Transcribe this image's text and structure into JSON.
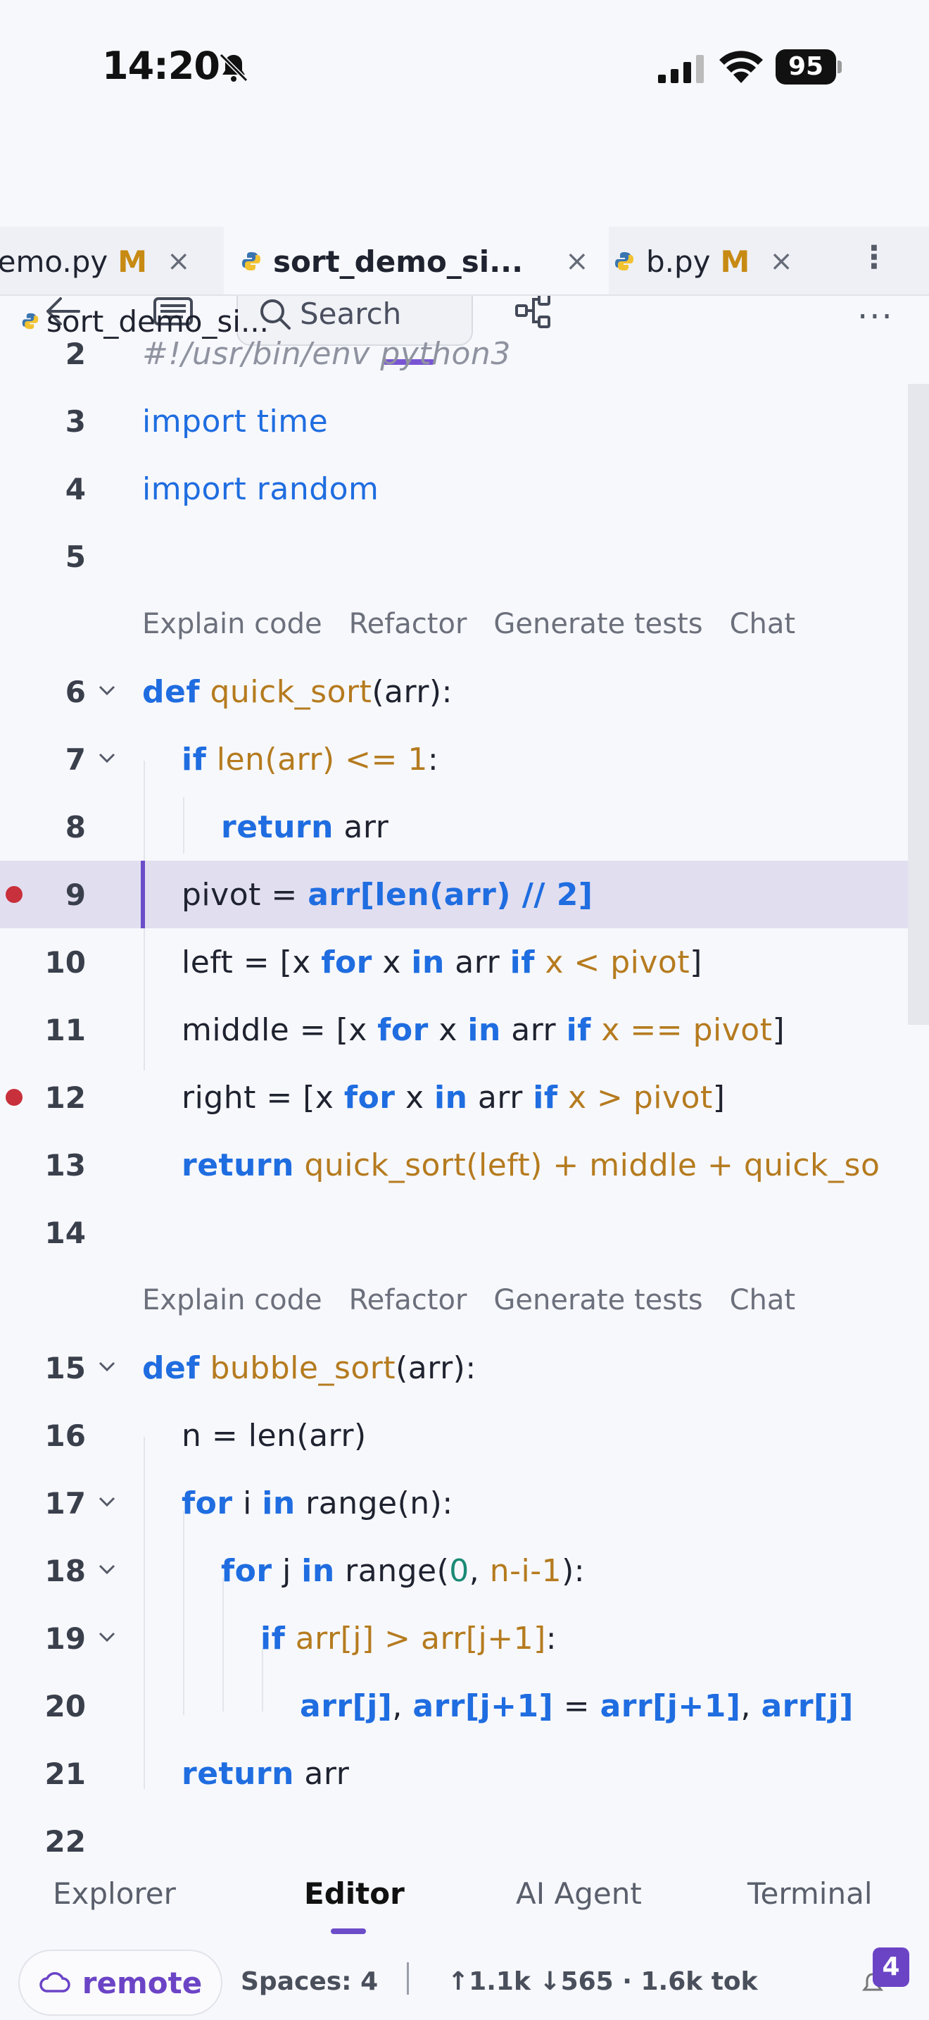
{
  "status_bar": {
    "time": "14:20",
    "battery": "95"
  },
  "toolbar": {
    "search_placeholder": "Search"
  },
  "tabs": [
    {
      "name": "demo.py",
      "modified": "M",
      "close": "×"
    },
    {
      "name": "sort_demo_si...",
      "modified": "",
      "close": "×"
    },
    {
      "name": "b.py",
      "modified": "M",
      "close": "×"
    }
  ],
  "tabs_menu": "⋮",
  "breadcrumb": "sort_demo_si...",
  "codelens": [
    "Explain code",
    "Refactor",
    "Generate tests",
    "Chat"
  ],
  "lines": {
    "l2": {
      "num": "2",
      "t": "#!/usr/bin/env python3"
    },
    "l3": {
      "num": "3",
      "a": "import",
      "b": " time"
    },
    "l4": {
      "num": "4",
      "a": "import",
      "b": " random"
    },
    "l5": {
      "num": "5"
    },
    "l6": {
      "num": "6",
      "a": "def",
      "b": " quick_sort",
      "c": "(arr):"
    },
    "l7": {
      "num": "7",
      "a": "if",
      "b": " len(arr) <= ",
      "c": "1",
      "d": ":"
    },
    "l8": {
      "num": "8",
      "a": "return",
      "b": " arr"
    },
    "l9": {
      "num": "9",
      "a": "pivot = ",
      "b": "arr[len(arr) // 2]"
    },
    "l10": {
      "num": "10",
      "a": "left = [x ",
      "b": "for",
      "c": " x ",
      "d": "in",
      "e": " arr ",
      "f": "if",
      "g": " x < pivot",
      "h": "]"
    },
    "l11": {
      "num": "11",
      "a": "middle = [x ",
      "b": "for",
      "c": " x ",
      "d": "in",
      "e": " arr ",
      "f": "if",
      "g": " x == pivot",
      "h": "]"
    },
    "l12": {
      "num": "12",
      "a": "right = [x ",
      "b": "for",
      "c": " x ",
      "d": "in",
      "e": " arr ",
      "f": "if",
      "g": " x > pivot",
      "h": "]"
    },
    "l13": {
      "num": "13",
      "a": "return",
      "b": " quick_sort(left) + middle + quick_so"
    },
    "l14": {
      "num": "14"
    },
    "l15": {
      "num": "15",
      "a": "def",
      "b": " bubble_sort",
      "c": "(arr):"
    },
    "l16": {
      "num": "16",
      "a": "n = len(arr)"
    },
    "l17": {
      "num": "17",
      "a": "for",
      "b": " i ",
      "c": "in",
      "d": " range(n):"
    },
    "l18": {
      "num": "18",
      "a": "for",
      "b": " j ",
      "c": "in",
      "d": " range(",
      "e": "0",
      "f": ", ",
      "g": "n-i-1",
      "h": "):"
    },
    "l19": {
      "num": "19",
      "a": "if",
      "b": " arr[j] > arr[j+1]",
      "c": ":"
    },
    "l20": {
      "num": "20",
      "a": "arr[j]",
      "b": ", ",
      "c": "arr[j+1]",
      "d": " = ",
      "e": "arr[j+1]",
      "f": ", ",
      "g": "arr[j]"
    },
    "l21": {
      "num": "21",
      "a": "return",
      "b": " arr"
    },
    "l22": {
      "num": "22"
    }
  },
  "bottom_nav": [
    "Explorer",
    "Editor",
    "AI Agent",
    "Terminal"
  ],
  "footer": {
    "remote": "remote",
    "spaces": "Spaces: 4",
    "stats": "↑1.1k ↓565 · 1.6k tok",
    "badge": "4"
  }
}
